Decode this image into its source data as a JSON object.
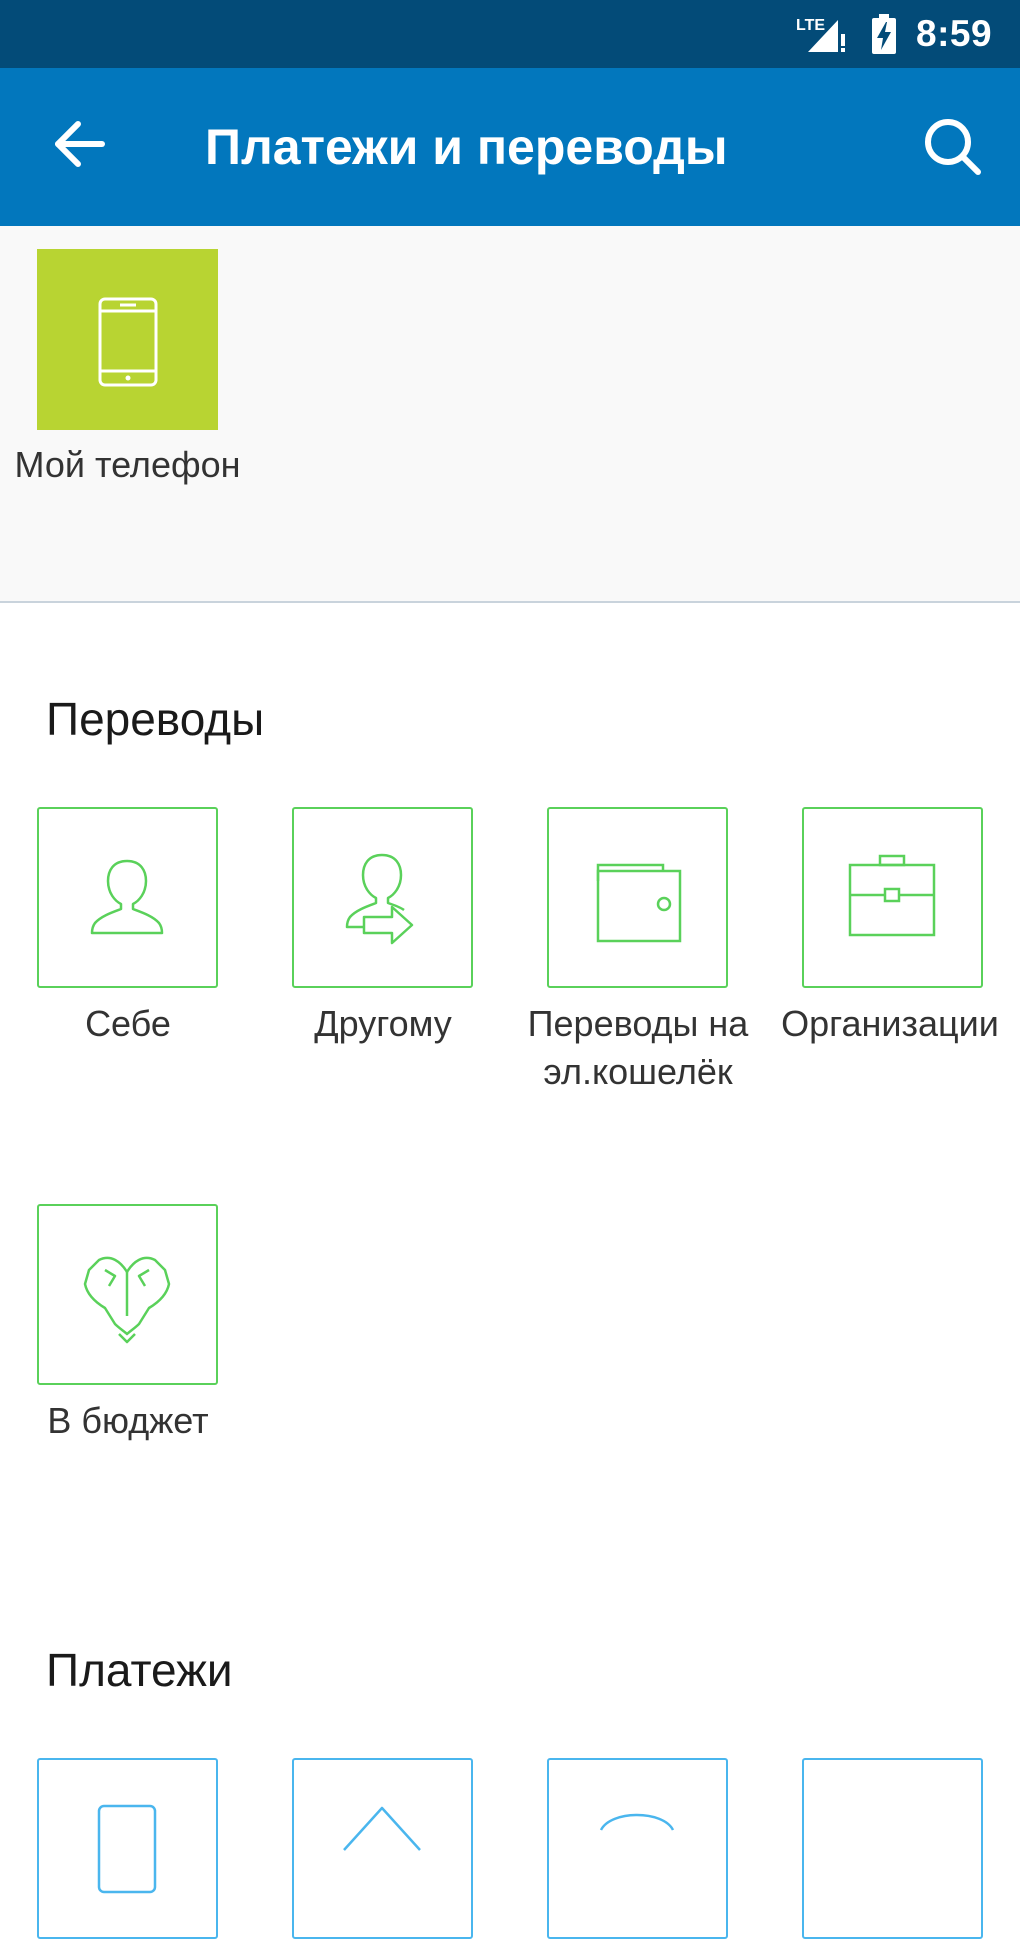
{
  "status_bar": {
    "network": "LTE",
    "time": "8:59"
  },
  "app_bar": {
    "title": "Платежи и переводы",
    "back_icon": "arrow-left-icon",
    "search_icon": "search-icon"
  },
  "favorites": {
    "items": [
      {
        "label": "Мой телефон",
        "icon": "smartphone-icon",
        "color": "#b8d432"
      }
    ]
  },
  "transfers": {
    "title": "Переводы",
    "items": [
      {
        "label": "Себе",
        "icon": "person-icon"
      },
      {
        "label": "Другому",
        "icon": "person-transfer-icon"
      },
      {
        "label": "Переводы на эл.кошелёк",
        "icon": "wallet-icon"
      },
      {
        "label": "Организации",
        "icon": "briefcase-icon"
      },
      {
        "label": "В бюджет",
        "icon": "eagle-emblem-icon"
      }
    ],
    "color": "#5ad15a"
  },
  "payments": {
    "title": "Платежи",
    "color": "#4ab6ee"
  }
}
